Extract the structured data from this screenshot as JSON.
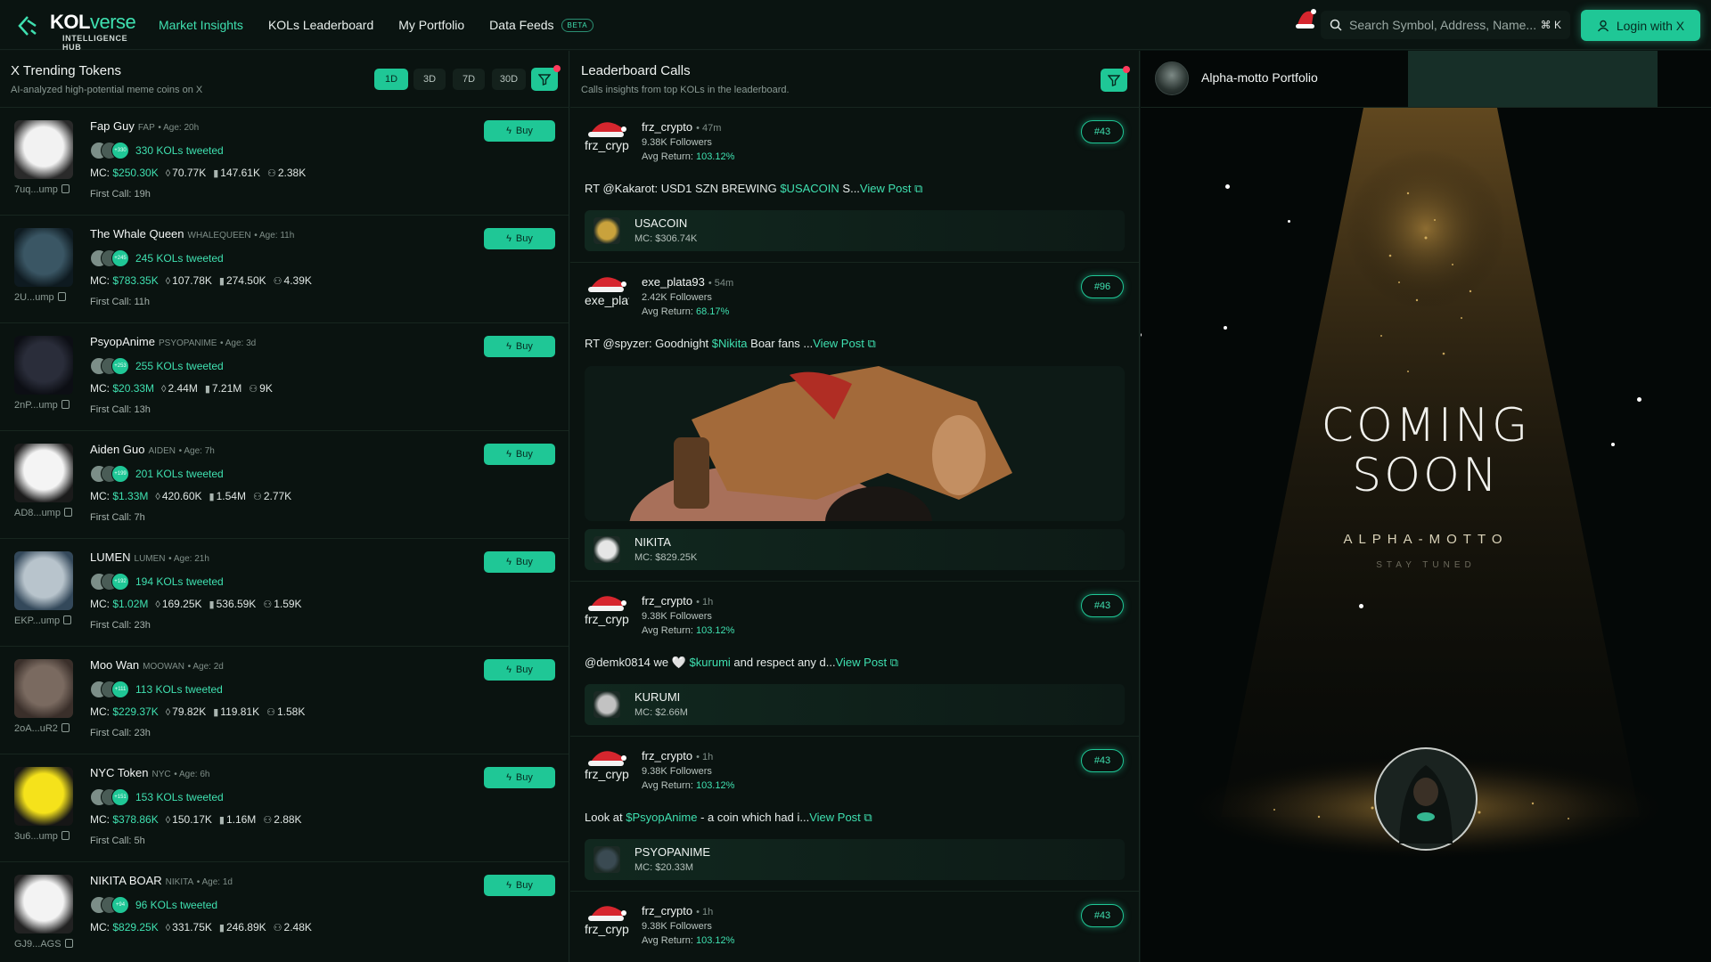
{
  "brand": {
    "name_a": "KOL",
    "name_b": "verse",
    "subtitle": "INTELLIGENCE HUB"
  },
  "nav": {
    "links": [
      {
        "label": "Market Insights",
        "active": true
      },
      {
        "label": "KOLs Leaderboard",
        "active": false
      },
      {
        "label": "My Portfolio",
        "active": false
      },
      {
        "label": "Data Feeds",
        "active": false,
        "badge": "BETA"
      }
    ],
    "search_placeholder": "Search Symbol, Address, Name...",
    "search_shortcut": "⌘ K",
    "login_label": "Login with X"
  },
  "trending": {
    "title": "X Trending Tokens",
    "subtitle": "AI-analyzed high-potential meme coins on X",
    "timeframes": [
      "1D",
      "3D",
      "7D",
      "30D"
    ],
    "selected_timeframe": "1D",
    "buy_label": "Buy",
    "tokens": [
      {
        "name": "Fap Guy",
        "ticker": "FAP",
        "age": "• Age: 20h",
        "kol_count": "330 KOLs tweeted",
        "avatar_badge": "+330",
        "mc": "$250.30K",
        "holders": "70.77K",
        "volume": "147.61K",
        "users": "2.38K",
        "first_call": "First Call: 19h",
        "address": "7uq...ump"
      },
      {
        "name": "The Whale Queen",
        "ticker": "WHALEQUEEN",
        "age": "• Age: 11h",
        "kol_count": "245 KOLs tweeted",
        "avatar_badge": "+245",
        "mc": "$783.35K",
        "holders": "107.78K",
        "volume": "274.50K",
        "users": "4.39K",
        "first_call": "First Call: 11h",
        "address": "2U...ump"
      },
      {
        "name": "PsyopAnime",
        "ticker": "PSYOPANIME",
        "age": "• Age: 3d",
        "kol_count": "255 KOLs tweeted",
        "avatar_badge": "+253",
        "mc": "$20.33M",
        "holders": "2.44M",
        "volume": "7.21M",
        "users": "9K",
        "first_call": "First Call: 13h",
        "address": "2nP...ump"
      },
      {
        "name": "Aiden Guo",
        "ticker": "AIDEN",
        "age": "• Age: 7h",
        "kol_count": "201 KOLs tweeted",
        "avatar_badge": "+199",
        "mc": "$1.33M",
        "holders": "420.60K",
        "volume": "1.54M",
        "users": "2.77K",
        "first_call": "First Call: 7h",
        "address": "AD8...ump"
      },
      {
        "name": "LUMEN",
        "ticker": "LUMEN",
        "age": "• Age: 21h",
        "kol_count": "194 KOLs tweeted",
        "avatar_badge": "+192",
        "mc": "$1.02M",
        "holders": "169.25K",
        "volume": "536.59K",
        "users": "1.59K",
        "first_call": "First Call: 23h",
        "address": "EKP...ump"
      },
      {
        "name": "Moo Wan",
        "ticker": "MOOWAN",
        "age": "• Age: 2d",
        "kol_count": "113 KOLs tweeted",
        "avatar_badge": "+111",
        "mc": "$229.37K",
        "holders": "79.82K",
        "volume": "119.81K",
        "users": "1.58K",
        "first_call": "First Call: 23h",
        "address": "2oA...uR2"
      },
      {
        "name": "NYC Token",
        "ticker": "NYC",
        "age": "• Age: 6h",
        "kol_count": "153 KOLs tweeted",
        "avatar_badge": "+151",
        "mc": "$378.86K",
        "holders": "150.17K",
        "volume": "1.16M",
        "users": "2.88K",
        "first_call": "First Call: 5h",
        "address": "3u6...ump"
      },
      {
        "name": "NIKITA BOAR",
        "ticker": "NIKITA",
        "age": "• Age: 1d",
        "kol_count": "96 KOLs tweeted",
        "avatar_badge": "+94",
        "mc": "$829.25K",
        "holders": "331.75K",
        "volume": "246.89K",
        "users": "2.48K",
        "first_call": "",
        "address": "GJ9...AGS"
      }
    ]
  },
  "calls": {
    "title": "Leaderboard Calls",
    "subtitle": "Calls insights from top KOLs in the leaderboard.",
    "view_post": "View Post",
    "items": [
      {
        "user": "frz_crypto",
        "time": "• 47m",
        "followers": "9.38K Followers",
        "avg_label": "Avg Return: ",
        "avg": "103.12%",
        "rank": "#43",
        "pre": "RT @Kakarot: USD1 SZN BREWING ",
        "sym": "$USACOIN",
        "post": " S...",
        "coin": "USACOIN",
        "coin_mc": "MC: $306.74K"
      },
      {
        "user": "exe_plata93",
        "time": "• 54m",
        "followers": "2.42K Followers",
        "avg_label": "Avg Return: ",
        "avg": "68.17%",
        "rank": "#96",
        "pre": "RT @spyzer: Goodnight ",
        "sym": "$Nikita",
        "post": " Boar fans ...",
        "coin": "NIKITA",
        "coin_mc": "MC: $829.25K"
      },
      {
        "user": "frz_crypto",
        "time": "• 1h",
        "followers": "9.38K Followers",
        "avg_label": "Avg Return: ",
        "avg": "103.12%",
        "rank": "#43",
        "pre": "@demk0814 we 🤍 ",
        "sym": "$kurumi",
        "post": " and respect any d...",
        "coin": "KURUMI",
        "coin_mc": "MC: $2.66M"
      },
      {
        "user": "frz_crypto",
        "time": "• 1h",
        "followers": "9.38K Followers",
        "avg_label": "Avg Return: ",
        "avg": "103.12%",
        "rank": "#43",
        "pre": "Look at ",
        "sym": "$PsyopAnime",
        "post": " - a coin which had i...",
        "coin": "PSYOPANIME",
        "coin_mc": "MC: $20.33M"
      },
      {
        "user": "frz_crypto",
        "time": "• 1h",
        "followers": "9.38K Followers",
        "avg_label": "Avg Return: ",
        "avg": "103.12%",
        "rank": "#43",
        "pre": "",
        "sym": "",
        "post": "",
        "coin": "",
        "coin_mc": ""
      }
    ]
  },
  "portfolio": {
    "title": "Alpha-motto Portfolio",
    "coming_1": "COMING",
    "coming_2": "SOON",
    "name": "ALPHA-MOTTO",
    "tagline": "STAY TUNED"
  },
  "colors": {
    "accent": "#1fc796",
    "accent_text": "#3fe0b0",
    "bg": "#0b1512",
    "alert_dot": "#ff3b5c"
  }
}
